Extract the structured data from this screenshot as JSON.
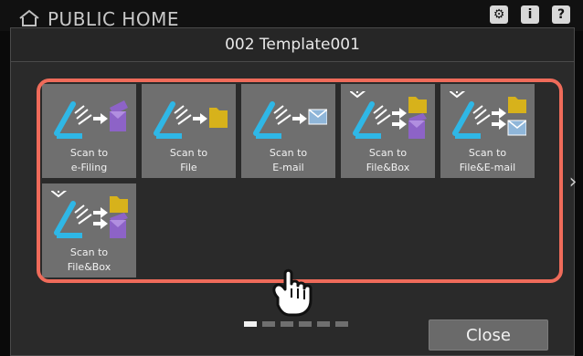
{
  "background": {
    "title": "PUBLIC HOME",
    "icons": [
      "home-icon",
      "gear-icon",
      "info-icon",
      "help-icon"
    ]
  },
  "dialog": {
    "title": "002 Template001",
    "close_label": "Close",
    "pagination": {
      "total_pages": 6,
      "current_page": 1
    },
    "next_icon": "chevron-right-icon"
  },
  "tiles": [
    {
      "label": "Scan to\ne-Filing",
      "icon": "scan-to-efiling-icon",
      "has_badge": false
    },
    {
      "label": "Scan to\nFile",
      "icon": "scan-to-file-icon",
      "has_badge": false
    },
    {
      "label": "Scan to\nE-mail",
      "icon": "scan-to-email-icon",
      "has_badge": false
    },
    {
      "label": "Scan to\nFile&Box",
      "icon": "scan-to-file-and-box-icon",
      "has_badge": true
    },
    {
      "label": "Scan to\nFile&E-mail",
      "icon": "scan-to-file-and-email-icon",
      "has_badge": true
    },
    {
      "label": "Scan to\nFile&Box",
      "icon": "scan-to-file-and-box-icon",
      "has_badge": true
    }
  ],
  "colors": {
    "highlight_frame": "#ef6b5a",
    "tile_bg": "#6f6f6f",
    "scanner_blue": "#2fb7e6",
    "folder_yellow": "#d7b21b",
    "box_purple": "#8d63c7",
    "mail_blue": "#8fb6d9"
  }
}
